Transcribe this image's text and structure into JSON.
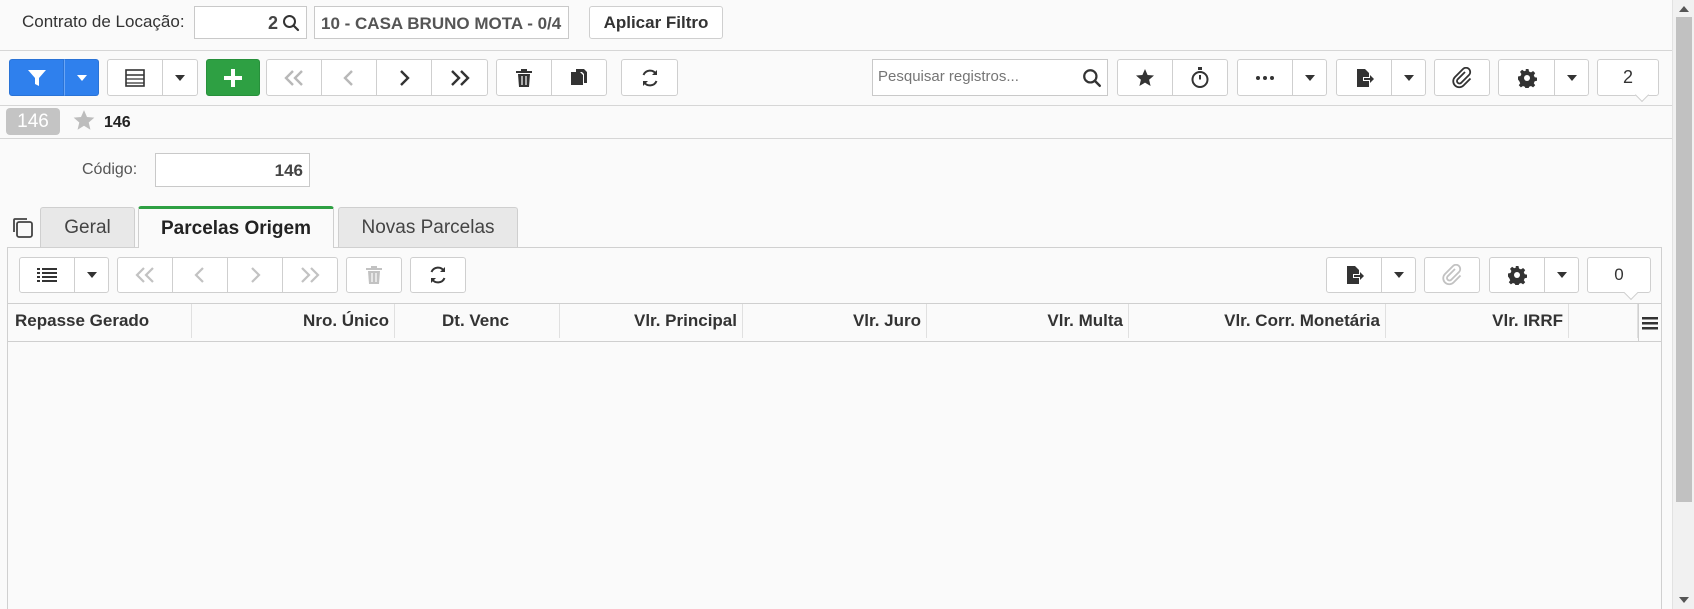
{
  "filter_bar": {
    "contract_label": "Contrato de Locação:",
    "contract_code": "2",
    "contract_description": "10 - CASA BRUNO MOTA - 0/4",
    "apply_label": "Aplicar Filtro"
  },
  "toolbar": {
    "search_placeholder": "Pesquisar registros...",
    "counter": "2"
  },
  "record": {
    "badge": "146",
    "title": "146",
    "code_label": "Código:",
    "code_value": "146"
  },
  "tabs": [
    {
      "label": "Geral",
      "active": false
    },
    {
      "label": "Parcelas Origem",
      "active": true
    },
    {
      "label": "Novas Parcelas",
      "active": false
    }
  ],
  "grid": {
    "counter": "0",
    "columns": [
      "Repasse Gerado",
      "Nro. Único",
      "Dt. Venc",
      "Vlr. Principal",
      "Vlr. Juro",
      "Vlr. Multa",
      "Vlr. Corr. Monetária",
      "Vlr. IRRF"
    ],
    "rows": []
  },
  "colors": {
    "primary": "#2f80ed",
    "success": "#2ea043",
    "active_tab": "#2ea043"
  }
}
